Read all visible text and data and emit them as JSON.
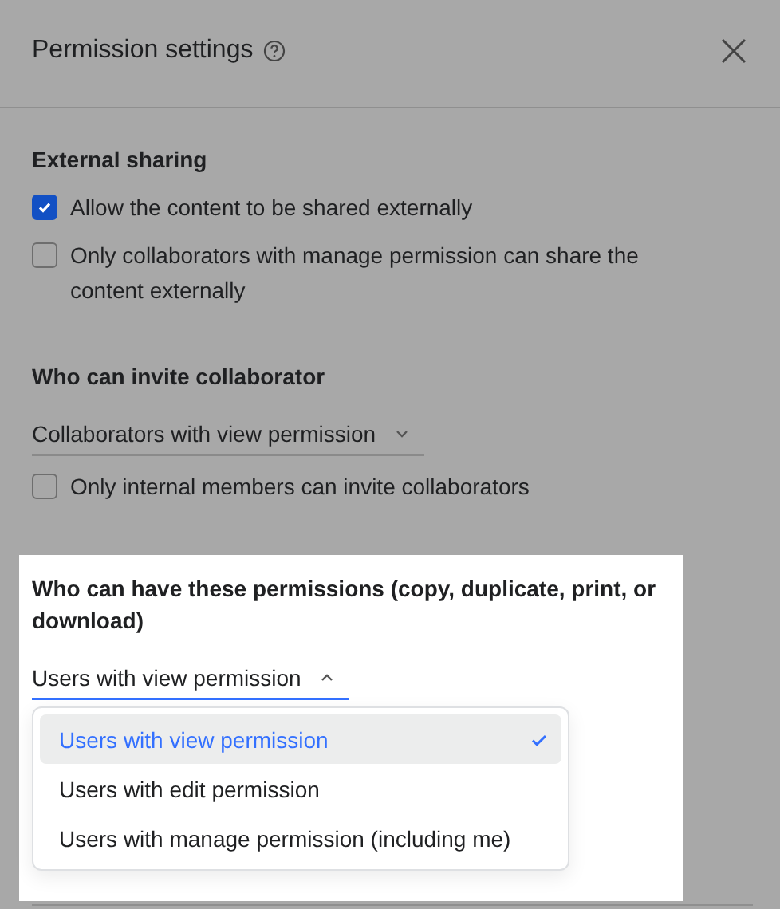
{
  "dialog": {
    "title": "Permission settings",
    "sections": [
      {
        "heading": "External sharing",
        "highlighted": false,
        "controls": [
          {
            "kind": "checkbox",
            "label": "Allow the content to be shared externally",
            "checked": true
          },
          {
            "kind": "checkbox",
            "label": "Only collaborators with manage permission can share the content externally",
            "checked": false
          }
        ]
      },
      {
        "heading": "Who can invite collaborator",
        "highlighted": false,
        "controls": [
          {
            "kind": "select",
            "value": "Collaborators with view permission",
            "expanded": false
          },
          {
            "kind": "checkbox",
            "label": "Only internal members can invite collaborators",
            "checked": false
          }
        ]
      },
      {
        "heading": "Who can have these permissions (copy, duplicate, print, or download)",
        "highlighted": true,
        "controls": [
          {
            "kind": "select",
            "value": "Users with view permission",
            "expanded": true,
            "options": [
              {
                "label": "Users with view permission",
                "selected": true
              },
              {
                "label": "Users with edit permission",
                "selected": false
              },
              {
                "label": "Users with manage permission (including me)",
                "selected": false
              }
            ]
          }
        ]
      }
    ]
  }
}
